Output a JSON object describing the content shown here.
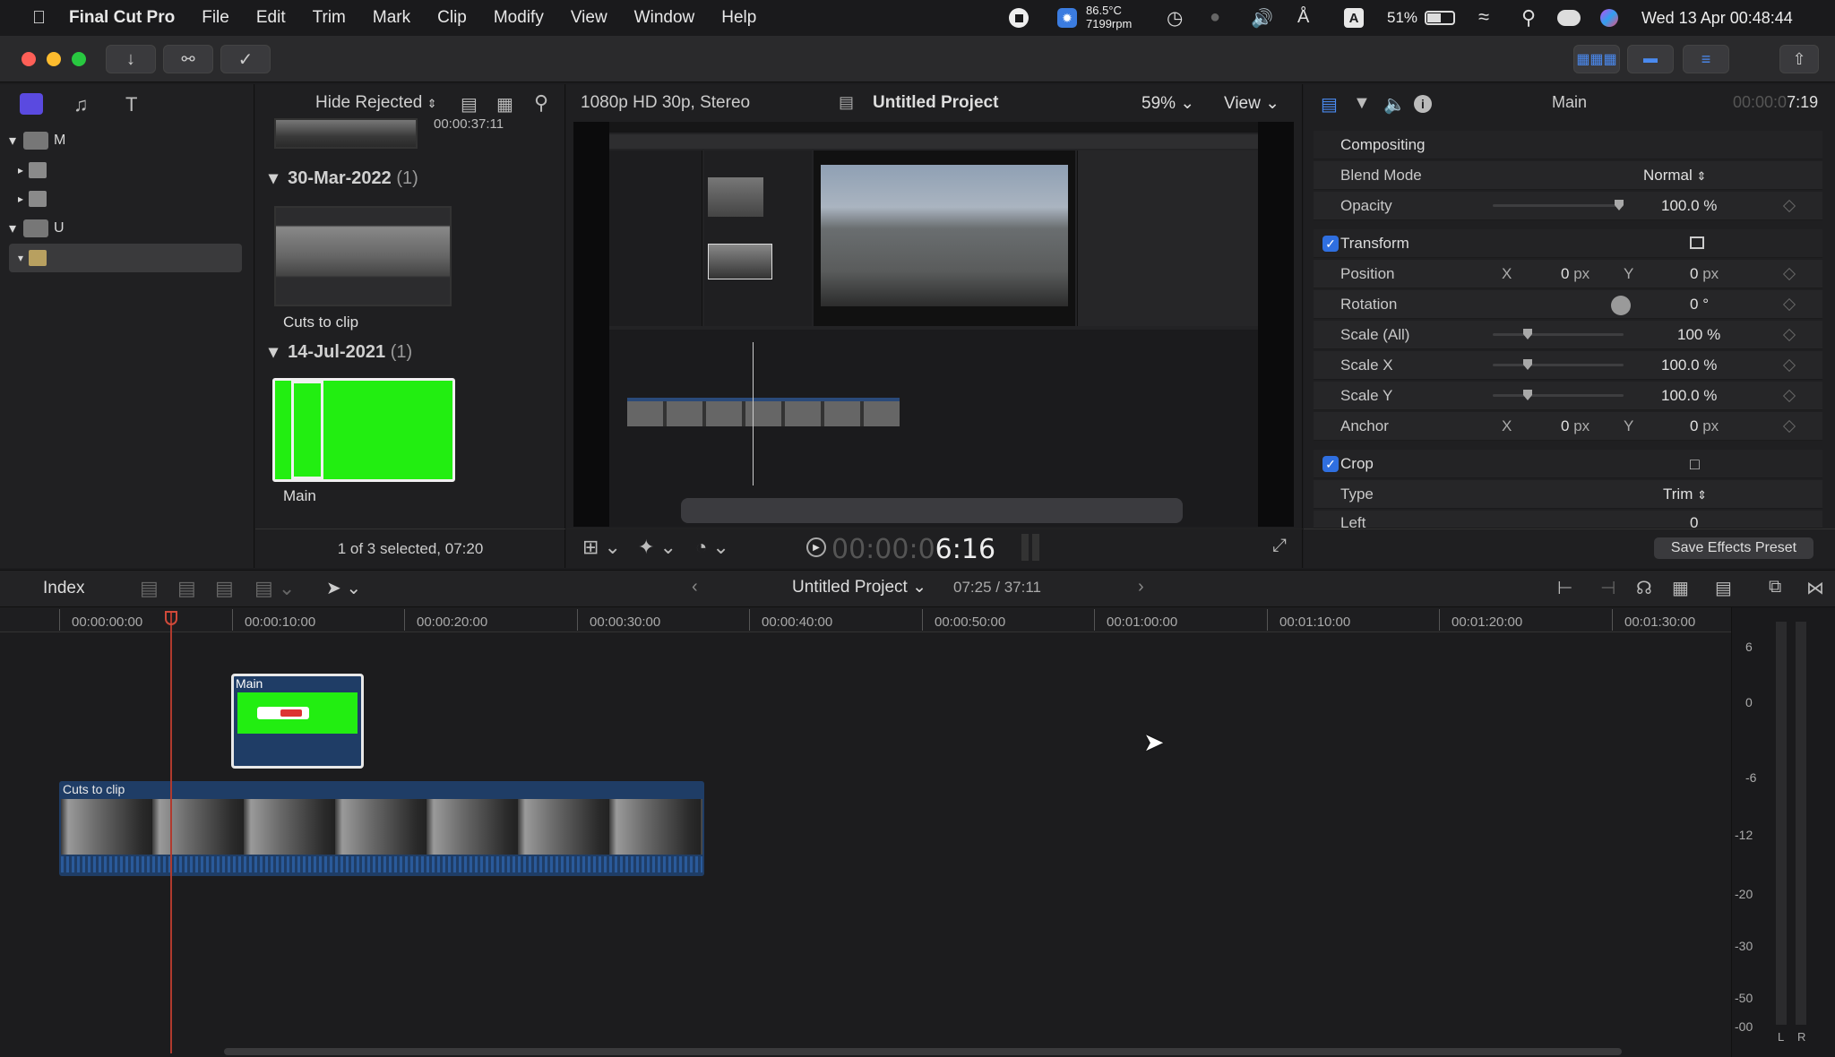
{
  "menubar": {
    "app_name": "Final Cut Pro",
    "menus": [
      "File",
      "Edit",
      "Trim",
      "Mark",
      "Clip",
      "Modify",
      "View",
      "Window",
      "Help"
    ],
    "temp": "86.5°C",
    "rpm": "7199rpm",
    "battery": "51%",
    "datetime": "Wed 13 Apr 00:48:44",
    "input_letter": "A"
  },
  "browser": {
    "filter_label": "Hide Rejected",
    "timecode_top": "00:00:37:11",
    "groups": [
      {
        "date": "30-Mar-2022",
        "count": "(1)",
        "clip_name": "Cuts to clip"
      },
      {
        "date": "14-Jul-2021",
        "count": "(1)",
        "clip_name": "Main"
      }
    ],
    "status": "1 of 3 selected, 07:20",
    "library_rows": [
      "M",
      "",
      "",
      "U",
      ""
    ]
  },
  "viewer": {
    "format": "1080p HD 30p, Stereo",
    "project_title": "Untitled Project",
    "zoom": "59%",
    "view_label": "View",
    "timecode_dim": "00:00:0",
    "timecode_bright": "6:16"
  },
  "inspector": {
    "title": "Main",
    "duration_dim": "00:00:0",
    "duration_bright": "7:19",
    "compositing_label": "Compositing",
    "blend_mode_label": "Blend Mode",
    "blend_mode_value": "Normal",
    "opacity_label": "Opacity",
    "opacity_value": "100.0",
    "opacity_unit": "%",
    "transform_label": "Transform",
    "position_label": "Position",
    "position_x": "0",
    "position_y": "0",
    "px_unit": "px",
    "x_label": "X",
    "y_label": "Y",
    "rotation_label": "Rotation",
    "rotation_value": "0",
    "rotation_unit": "°",
    "scale_all_label": "Scale (All)",
    "scale_all_value": "100",
    "scale_x_label": "Scale X",
    "scale_x_value": "100.0",
    "scale_y_label": "Scale Y",
    "scale_y_value": "100.0",
    "percent": "%",
    "anchor_label": "Anchor",
    "anchor_x": "0",
    "anchor_y": "0",
    "crop_label": "Crop",
    "type_label": "Type",
    "type_value": "Trim",
    "left_label": "Left",
    "left_value": "0",
    "save_preset": "Save Effects Preset"
  },
  "timeline": {
    "index_label": "Index",
    "project_name": "Untitled Project",
    "position": "07:25 / 37:11",
    "ruler": [
      "00:00:00:00",
      "00:00:10:00",
      "00:00:20:00",
      "00:00:30:00",
      "00:00:40:00",
      "00:00:50:00",
      "00:01:00:00",
      "00:01:10:00",
      "00:01:20:00",
      "00:01:30:00"
    ],
    "clip_main": "Main",
    "clip_cuts": "Cuts to clip",
    "meter_scale": [
      "6",
      "0",
      "-6",
      "-12",
      "-20",
      "-30",
      "-50",
      "-00"
    ],
    "meter_l": "L",
    "meter_r": "R"
  },
  "colors": {
    "accent_blue": "#2f6fe0",
    "green_screen": "#22ee11",
    "playhead": "#c0392b",
    "clip_blue": "#1f3d66"
  }
}
